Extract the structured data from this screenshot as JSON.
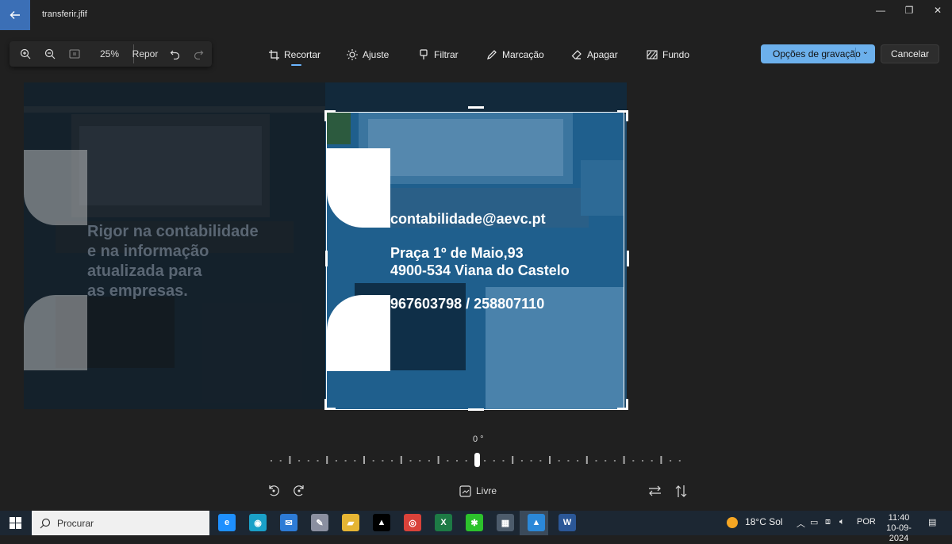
{
  "window": {
    "title": "transferir.jfif"
  },
  "zoom": {
    "level": "25%",
    "reset_label": "Repor"
  },
  "tools": [
    {
      "id": "recortar",
      "label": "Recortar"
    },
    {
      "id": "ajuste",
      "label": "Ajuste"
    },
    {
      "id": "filtrar",
      "label": "Filtrar"
    },
    {
      "id": "marcacao",
      "label": "Marcação"
    },
    {
      "id": "apagar",
      "label": "Apagar"
    },
    {
      "id": "fundo",
      "label": "Fundo"
    }
  ],
  "actions": {
    "save_label": "Opções de gravação",
    "cancel_label": "Cancelar"
  },
  "image": {
    "dim_text": [
      "Rigor na contabilidade",
      "e na informação",
      "atualizada para",
      "as empresas."
    ],
    "email": "contabilidade@aevc.pt",
    "address1": "Praça 1º de Maio,93",
    "address2": "4900-534 Viana do Castelo",
    "phones": "967603798 / 258807110"
  },
  "rotation": {
    "angle": "0 °",
    "aspect_label": "Livre"
  },
  "taskbar": {
    "search_placeholder": "Procurar",
    "weather": "18°C  Sol",
    "language": "POR",
    "time": "11:40",
    "date": "10-09-2024",
    "apps": [
      {
        "name": "internet-explorer-icon",
        "glyph": "e",
        "color": "#1e90ff"
      },
      {
        "name": "edge-icon",
        "glyph": "◉",
        "color": "#1aa0c8"
      },
      {
        "name": "mail-icon",
        "glyph": "✉",
        "color": "#2d7bd6"
      },
      {
        "name": "paint-icon",
        "glyph": "✎",
        "color": "#8a8fa0"
      },
      {
        "name": "file-explorer-icon",
        "glyph": "▰",
        "color": "#e5b534"
      },
      {
        "name": "delta-app-icon",
        "glyph": "▲",
        "color": "#000000"
      },
      {
        "name": "chrome-icon",
        "glyph": "◎",
        "color": "#d9423a"
      },
      {
        "name": "excel-icon",
        "glyph": "X",
        "color": "#1d7a45"
      },
      {
        "name": "xbox-icon",
        "glyph": "✱",
        "color": "#2cc22c"
      },
      {
        "name": "calculator-icon",
        "glyph": "▦",
        "color": "#4c5b6b"
      },
      {
        "name": "photos-icon",
        "glyph": "▲",
        "color": "#2b88d8"
      },
      {
        "name": "word-icon",
        "glyph": "W",
        "color": "#2b5797"
      }
    ]
  }
}
